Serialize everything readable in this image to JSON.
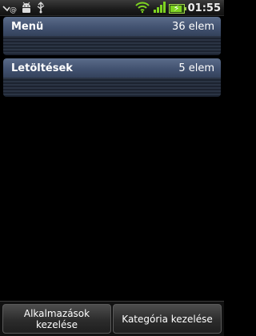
{
  "status_bar": {
    "left_icons": [
      "missed-call-icon",
      "android-debug-icon",
      "usb-icon"
    ],
    "right_icons": [
      "wifi-icon",
      "signal-icon",
      "battery-charging-icon"
    ],
    "battery_level": 0.85,
    "time": "01:55"
  },
  "categories": [
    {
      "title": "Menü",
      "count": "36 elem"
    },
    {
      "title": "Letöltések",
      "count": "5 elem"
    }
  ],
  "bottom_buttons": {
    "manage_apps": "Alkalmazások kezelése",
    "manage_category": "Kategória kezelése"
  },
  "colors": {
    "category_header": "#425270",
    "background": "#000000",
    "battery": "#7ed321"
  }
}
